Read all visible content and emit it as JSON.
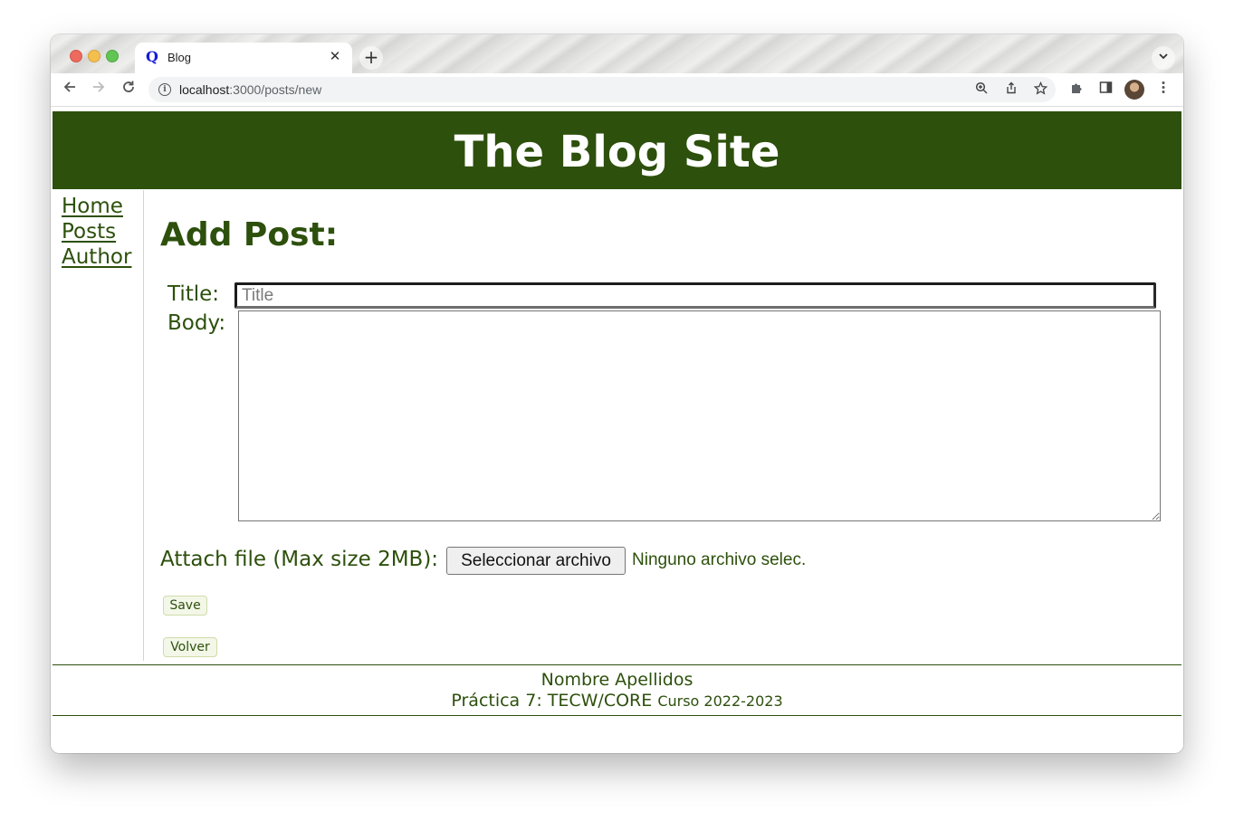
{
  "browser": {
    "tab_title": "Blog",
    "favicon_text": "Q",
    "tab_close": "✕",
    "new_tab": "+",
    "url_host": "localhost",
    "url_path": ":3000/posts/new"
  },
  "site": {
    "header_title": "The Blog Site",
    "nav": [
      "Home",
      "Posts",
      "Author"
    ]
  },
  "form": {
    "heading": "Add Post:",
    "title_label": "Title:",
    "title_placeholder": "Title",
    "body_label": "Body:",
    "attach_label": "Attach file (Max size 2MB):",
    "file_button": "Seleccionar archivo",
    "file_status": "Ninguno archivo selec.",
    "save_button": "Save",
    "back_button": "Volver"
  },
  "footer": {
    "line1": "Nombre Apellidos",
    "line2": "Práctica 7: TECW/CORE",
    "line2_small": "Curso 2022-2023"
  },
  "colors": {
    "brand_green": "#2d500c",
    "white": "#ffffff"
  }
}
